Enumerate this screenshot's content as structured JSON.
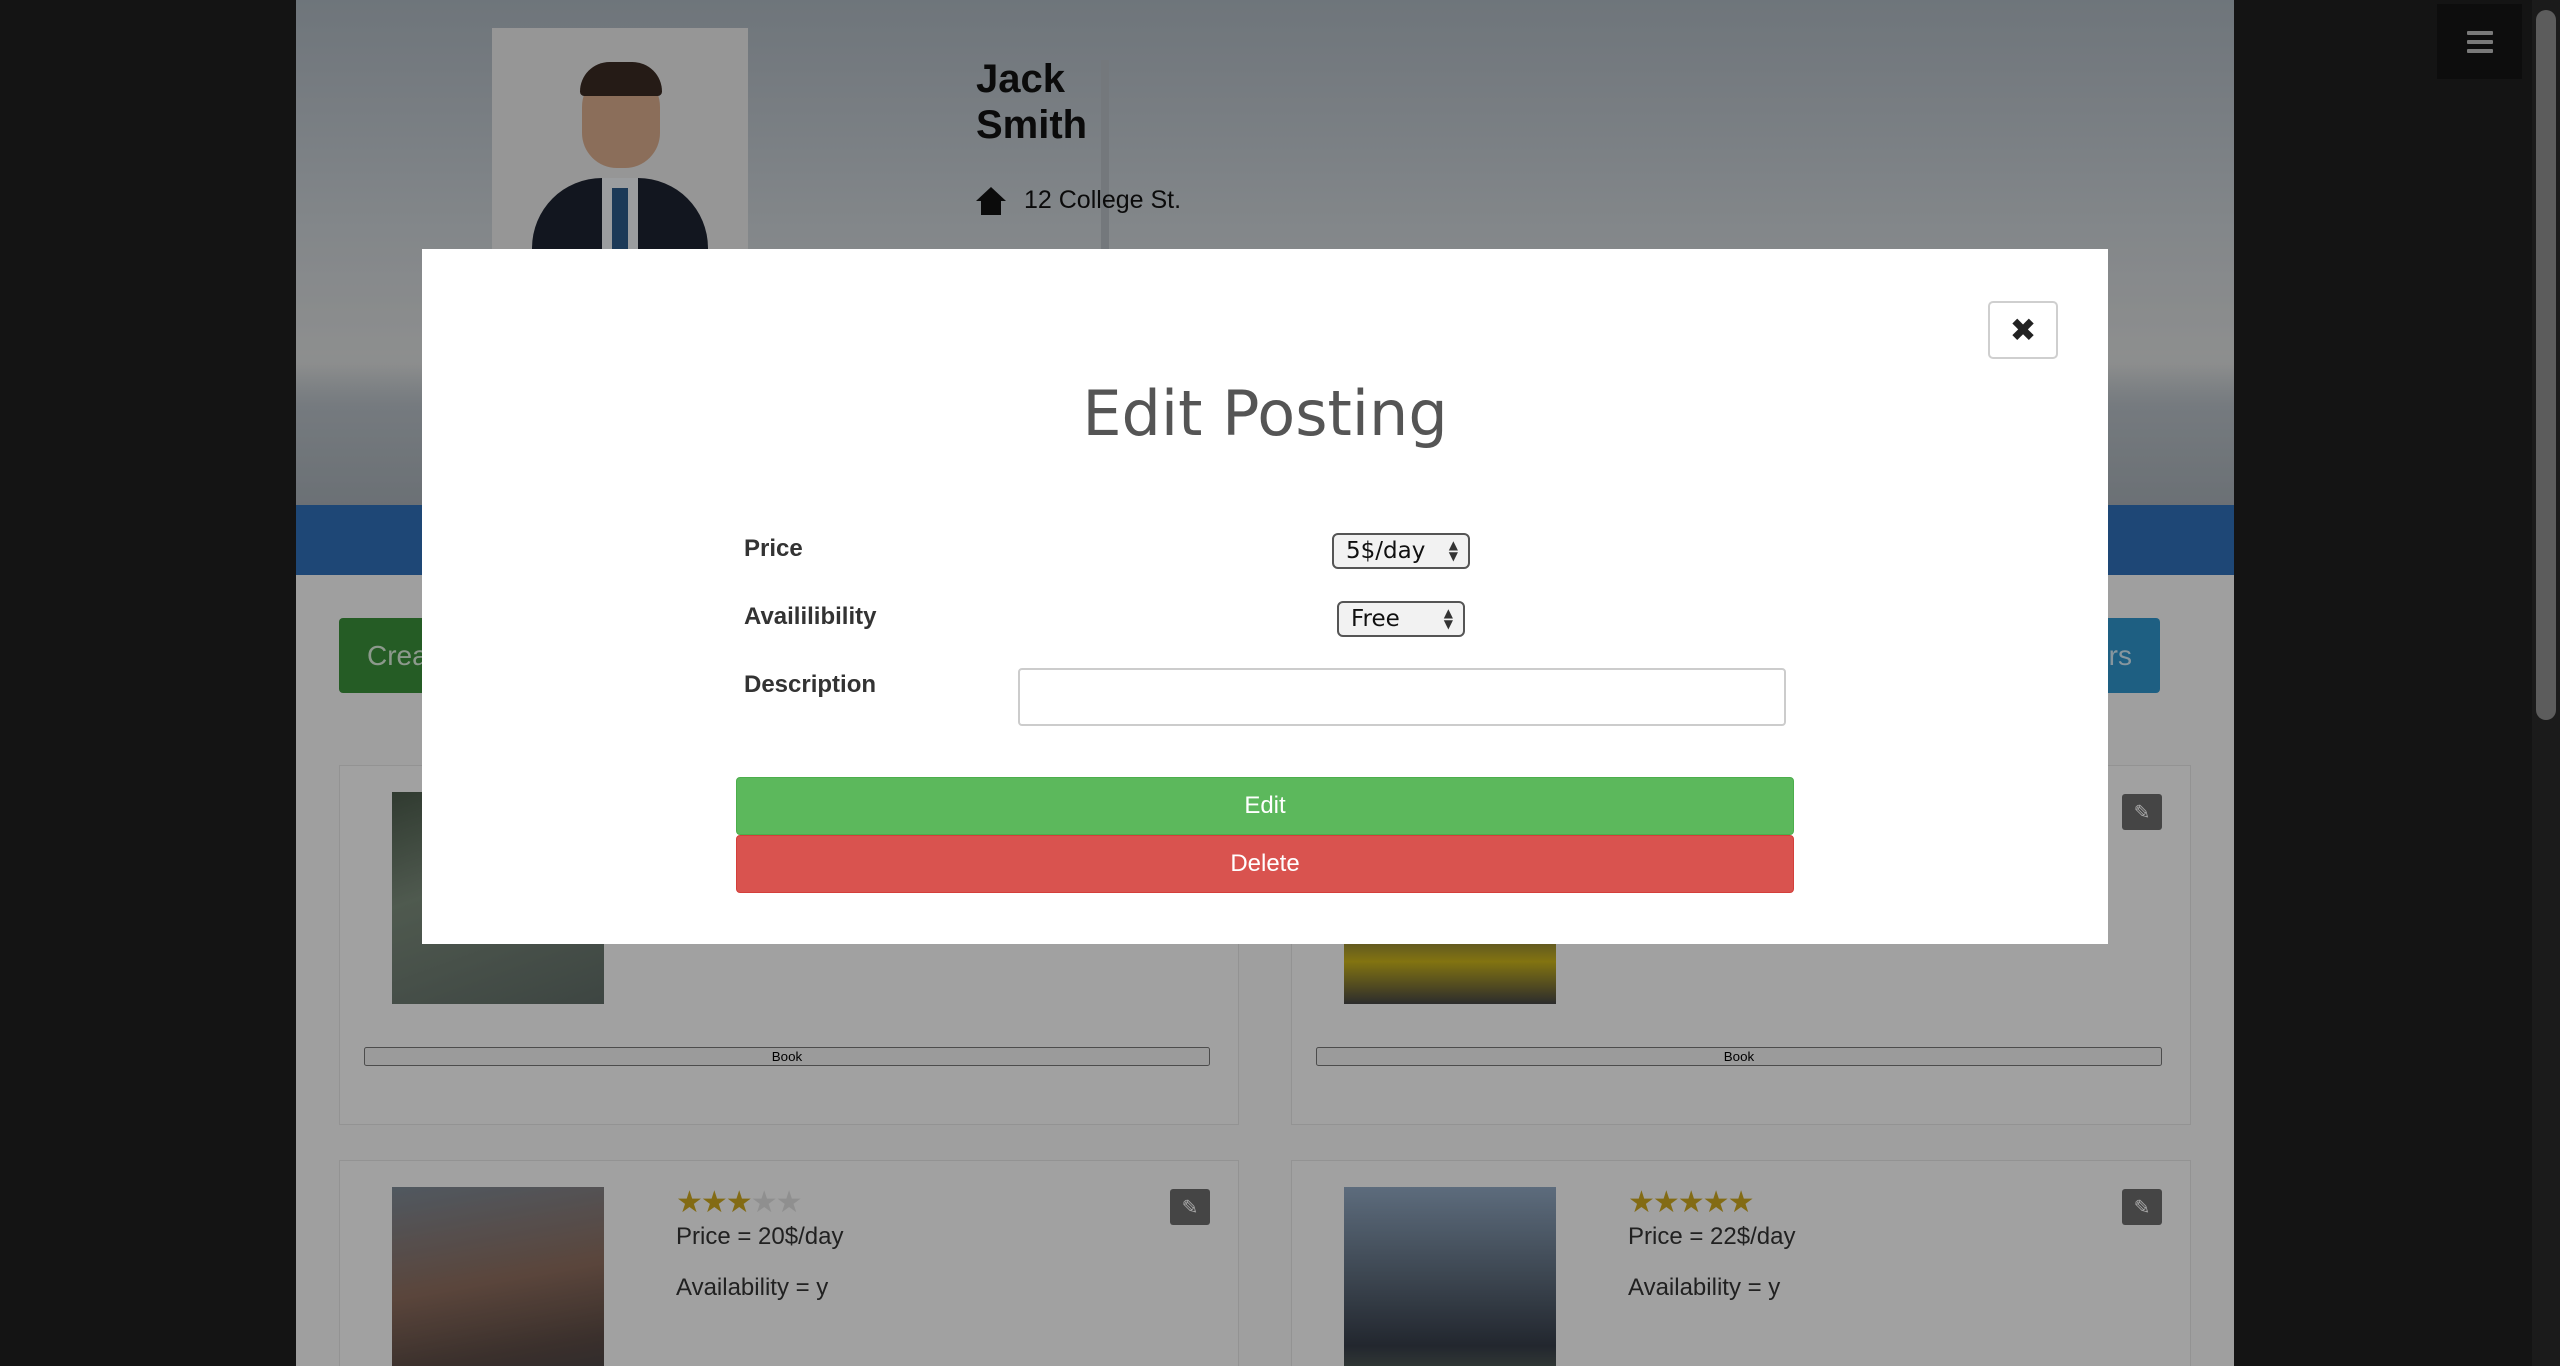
{
  "profile": {
    "first_name": "Jack",
    "last_name": "Smith",
    "address": "12 College St."
  },
  "actions": {
    "create_label": "Crea",
    "right_label": "rs"
  },
  "postings": [
    {
      "rating": 3,
      "price": "Price = 20$/day",
      "availability": "Availability = y",
      "book_label": "Book"
    },
    {
      "rating": 5,
      "price": "Price = 22$/day",
      "availability": "Availability = y",
      "book_label": "Book"
    }
  ],
  "top_book_labels": [
    "Book",
    "Book"
  ],
  "modal": {
    "title": "Edit Posting",
    "price_label": "Price",
    "price_value": "5$/day",
    "availability_label": "Availilibility",
    "availability_value": "Free",
    "description_label": "Description",
    "description_value": "",
    "edit_label": "Edit",
    "delete_label": "Delete",
    "close_icon": "close-icon"
  },
  "colors": {
    "edit_button": "#5cb85c",
    "delete_button": "#d9534f",
    "book_button": "#358a35",
    "nav_bar": "#2f6db5"
  }
}
